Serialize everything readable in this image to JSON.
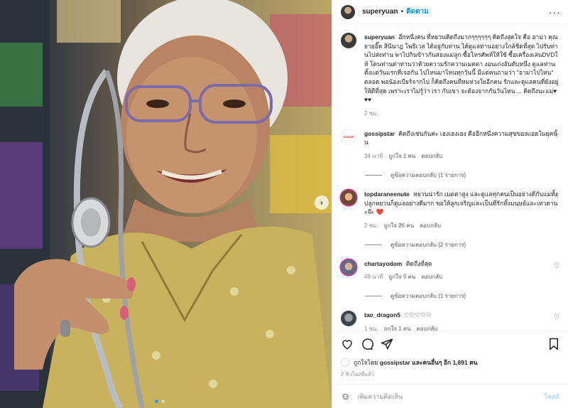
{
  "post": {
    "username": "superyuan",
    "separator": "•",
    "follow_label": "ติดตาม",
    "more_icon": "more-horizontal-icon"
  },
  "caption": {
    "username": "superyuan",
    "text": "อีกหนึ่งคน ที่หยวนคิดถึงมากๆๆๆๆๆๆ คิดถึงสุดใจ คือ อาม่า คุณยายอิ๊ด สินีนาฎ โพธิเวส ได้อยู่กับท่าน ได้ดูแลท่านอย่างใกล้ชิดที่สุด ไปรับท่านไปส่งท่าน พาไปกินข้าวกันสองแม่ลูก ซื้อโทรศัพท์ให้ใช้ ซื้อเครื่องเล่นDVDให้ โดนท่านด่าท่านว่าด้วยความรักความเมตตา งอนเก่งอันดับหนึ่ง ดูแลท่านตั้งแต่วันแรกที่เจอกัน ไปไหนมาไหนทุกวันนี้ มีแต่คนถามว่า \"อาม่าไปไหน\" ตลอด พอน้องเบียร์จากไป ก็คิดถึงคนที่หมห่วงใยอีกคน รักและดูแลคนที่ยังอยู่ให้ดีที่สุด เพราะเราไม่รู้ว่า เรา กับเขา จะต้องจากกันวันไหน ... คิดถึงนะแม่♥♥♥",
    "time": "2 ชม."
  },
  "comments": [
    {
      "username": "gossipstar",
      "avatar_label": "GOSSIP",
      "text": "คิดถึงเช่นกันค่ะ เฮงเฮงเฮง คืออีกหนึ่งความสุขของแอดในยุคนั้น",
      "time": "34 นาที",
      "likes": "ถูกใจ 1 คน",
      "reply_label": "ตอบกลับ",
      "view_replies": "ดูข้อความตอบกลับ (1 รายการ)"
    },
    {
      "username": "topdaraneenute",
      "text": "หยวนน่ารัก เมตตาสูง และดูแลทุกคนเป็นอย่างดีกับแม่ทั้งปลูกหยวนก็ดูแลอย่างดีมาก ขอให้ลูกเจริญและเป็นที่รักทั้งมนุษย์และเทวดานะจ๊ะ ❤️",
      "time": "2 ชม.",
      "likes": "ถูกใจ 26 คน",
      "reply_label": "ตอบกลับ",
      "view_replies": "ดูข้อความตอบกลับ (2 รายการ)"
    },
    {
      "username": "chartayodom",
      "text": "คิดถึงที่สุด",
      "time": "49 นาที",
      "likes": "ถูกใจ 5 คน",
      "reply_label": "ตอบกลับ",
      "view_replies": "ดูข้อความตอบกลับ (1 รายการ)"
    },
    {
      "username": "tao_dragon5",
      "text": "♡♡♡♡♡",
      "time": "1 ชม.",
      "likes": "ถูกใจ 1 คน",
      "reply_label": "ตอบกลับ"
    }
  ],
  "footer": {
    "liked_by_prefix": "ถูกใจโดย",
    "liked_by_user": "gossipstar",
    "liked_by_suffix": "และคนอื่นๆ อีก 1,891 คน",
    "time": "2 ชั่วโมงที่แล้ว",
    "comment_placeholder": "เพิ่มความคิดเห็น",
    "post_label": "โพสต์"
  },
  "icons": {
    "like": "heart-icon",
    "comment": "comment-icon",
    "share": "send-icon",
    "save": "bookmark-icon",
    "emoji": "emoji-icon"
  }
}
